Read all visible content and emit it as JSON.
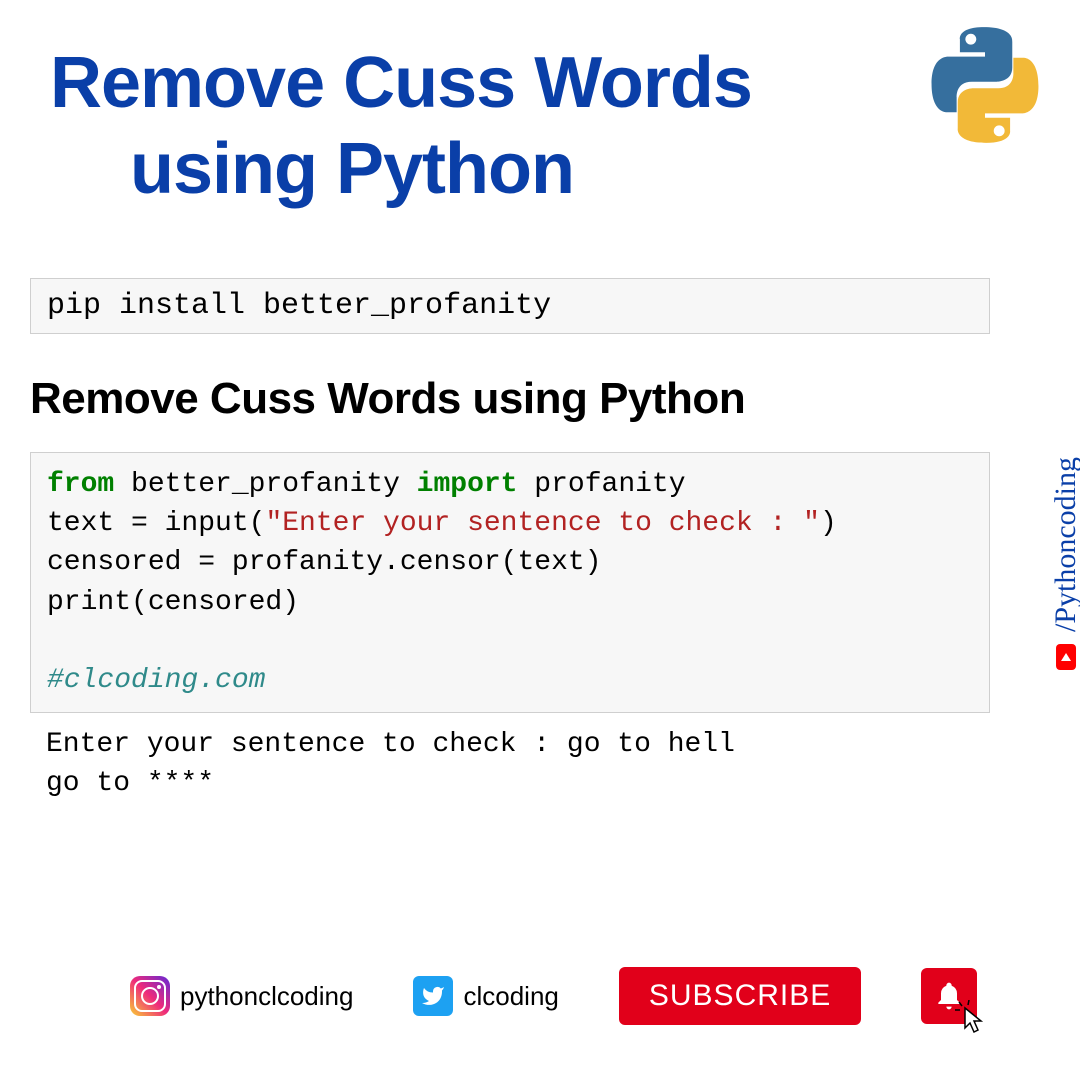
{
  "header": {
    "title_line1": "Remove Cuss Words",
    "title_line2": "using Python"
  },
  "content": {
    "install_cmd": "pip install better_profanity",
    "subheading": "Remove Cuss Words using Python",
    "code": {
      "kw_from": "from",
      "module": " better_profanity ",
      "kw_import": "import",
      "name": " profanity",
      "line2a": "text = input(",
      "line2str": "\"Enter your sentence to check : \"",
      "line2b": ")",
      "line3": "censored = profanity.censor(text)",
      "line4": "print(censored)",
      "comment": "#clcoding.com"
    },
    "output": {
      "line1": "Enter your sentence to check : go to hell",
      "line2": "go to ****"
    }
  },
  "side": {
    "handle": "/Pythoncoding"
  },
  "footer": {
    "instagram": "pythonclcoding",
    "twitter": "clcoding",
    "subscribe": "SUBSCRIBE"
  }
}
